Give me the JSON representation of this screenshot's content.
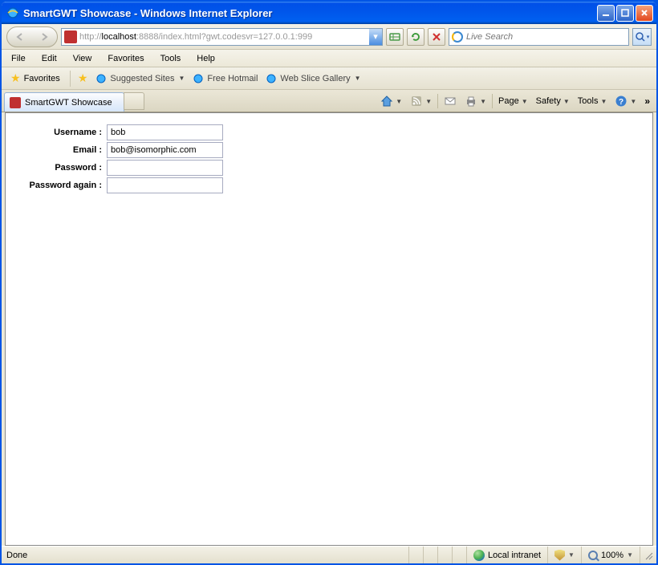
{
  "titlebar": {
    "title": "SmartGWT Showcase - Windows Internet Explorer"
  },
  "address": {
    "prefix": "http://",
    "host": "localhost",
    "rest": ":8888/index.html?gwt.codesvr=127.0.0.1:999"
  },
  "search": {
    "placeholder": "Live Search"
  },
  "menu": {
    "file": "File",
    "edit": "Edit",
    "view": "View",
    "favorites": "Favorites",
    "tools": "Tools",
    "help": "Help"
  },
  "favbar": {
    "favorites": "Favorites",
    "suggested": "Suggested Sites",
    "hotmail": "Free Hotmail",
    "webslice": "Web Slice Gallery"
  },
  "tab": {
    "title": "SmartGWT Showcase"
  },
  "toolbar_right": {
    "page": "Page",
    "safety": "Safety",
    "tools": "Tools"
  },
  "form": {
    "username_label": "Username :",
    "username_value": "bob",
    "email_label": "Email :",
    "email_value": "bob@isomorphic.com",
    "password_label": "Password :",
    "password_value": "",
    "password2_label": "Password again :",
    "password2_value": ""
  },
  "status": {
    "done": "Done",
    "zone": "Local intranet",
    "zoom": "100%"
  }
}
